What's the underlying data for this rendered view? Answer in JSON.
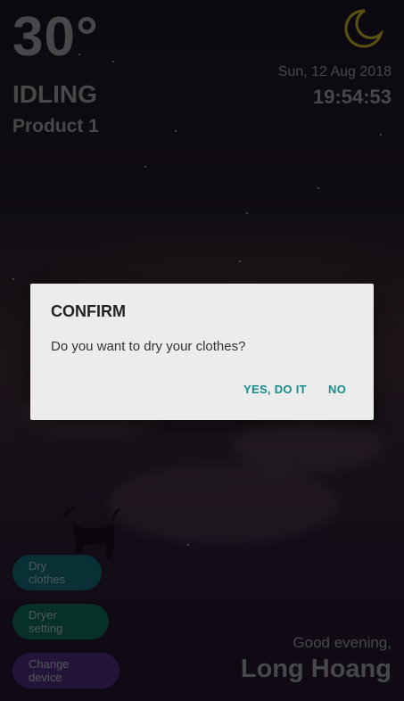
{
  "weather": {
    "temperature": "30°",
    "icon": "crescent-moon-icon"
  },
  "device": {
    "status": "IDLING",
    "product": "Product 1"
  },
  "clock": {
    "date": "Sun, 12 Aug 2018",
    "time": "19:54:53"
  },
  "actions": {
    "dry_clothes": "Dry clothes",
    "dryer_setting": "Dryer setting",
    "change_device": "Change device"
  },
  "greeting": {
    "text": "Good evening,",
    "name": "Long Hoang"
  },
  "dialog": {
    "title": "CONFIRM",
    "message": "Do you want to dry your clothes?",
    "confirm_label": "YES, DO IT",
    "cancel_label": "NO"
  },
  "colors": {
    "accent": "#138e8c",
    "moon": "#8c7f1f",
    "dry_button": "#0e4a52",
    "setting_button": "#0c4a3e",
    "device_button": "#3a1f5a"
  }
}
